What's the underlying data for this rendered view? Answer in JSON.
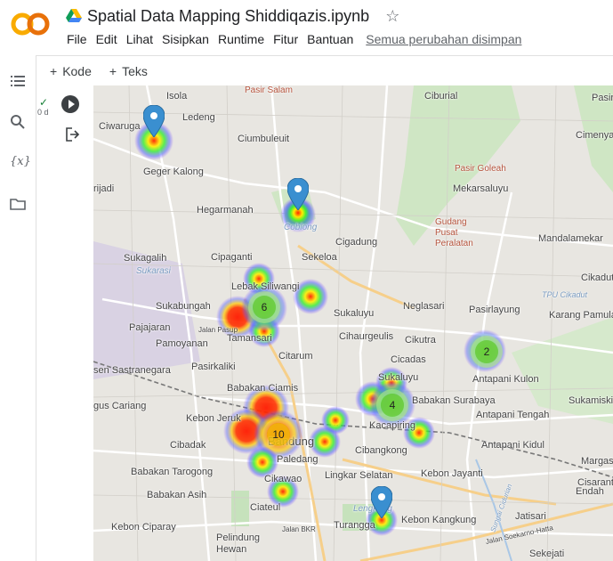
{
  "app": {
    "logo": "CO",
    "notebook_title": "Spatial Data Mapping Shiddiqazis.ipynb"
  },
  "menu": {
    "items": [
      "File",
      "Edit",
      "Lihat",
      "Sisipkan",
      "Runtime",
      "Fitur",
      "Bantuan"
    ],
    "saved_status": "Semua perubahan disimpan"
  },
  "toolbar": {
    "add_code": "Kode",
    "add_text": "Teks"
  },
  "cell": {
    "exec_time": "0 d"
  },
  "map": {
    "labels": [
      "Isola",
      "Ciwaruga",
      "Ledeng",
      "Pasir Salam",
      "Ciburial",
      "Cimenyan",
      "Ciumbuleuit",
      "Geger Kalong",
      "Pasir Goleah",
      "Mekarsaluyu",
      "rijadi",
      "Hegarmanah",
      "Coblong",
      "Cigadung",
      "Sukagalih",
      "Cipaganti",
      "Sekeloa",
      "Sukarasi",
      "Sukabungah",
      "Lebak Siliwangi",
      "Sukaluyu",
      "Neglasari",
      "Pasirlayung",
      "Pajajaran",
      "Jalan Pasup",
      "Tamansari",
      "Cihaurgeulis",
      "Cikutra",
      "Pamoyanan",
      "Citarum",
      "Cicadas",
      "Antapani Kulon",
      "sen Sastranegara",
      "Pasirkaliki",
      "Babakan Ciamis",
      "Sukaluyu",
      "Babakan Surabaya",
      "gus Cariang",
      "Kebon Jeruk",
      "Kacapiring",
      "Antapani Tengah",
      "Cibadak",
      "Bandung",
      "Cibangkong",
      "Antapani Kidul",
      "Babakan Tarogong",
      "Paledang",
      "Lingkar Selatan",
      "Kebon Jayanti",
      "Cikawao",
      "Babakan Asih",
      "Ciateul",
      "Lengkong",
      "Jatisari",
      "Kebon Kangkung",
      "Turangga",
      "Kebon Ciparay",
      "Pelindung Hewan",
      "Jalan BKR",
      "Sukamiskin",
      "Cikadut",
      "Mandalamekar",
      "Karang Pamulang",
      "TPU Cikadut",
      "Endah",
      "Margasari",
      "Pasirsaluyu",
      "Cisaranten",
      "Gudang Pusat Peralatan",
      "Jalan Soekarno-Hatta",
      "Sungai Cidurian",
      "Sekejati"
    ],
    "clusters": [
      {
        "count": "6",
        "color": "green"
      },
      {
        "count": "2",
        "color": "green"
      },
      {
        "count": "4",
        "color": "green"
      },
      {
        "count": "10",
        "color": "yellow"
      }
    ],
    "markers": 4
  }
}
